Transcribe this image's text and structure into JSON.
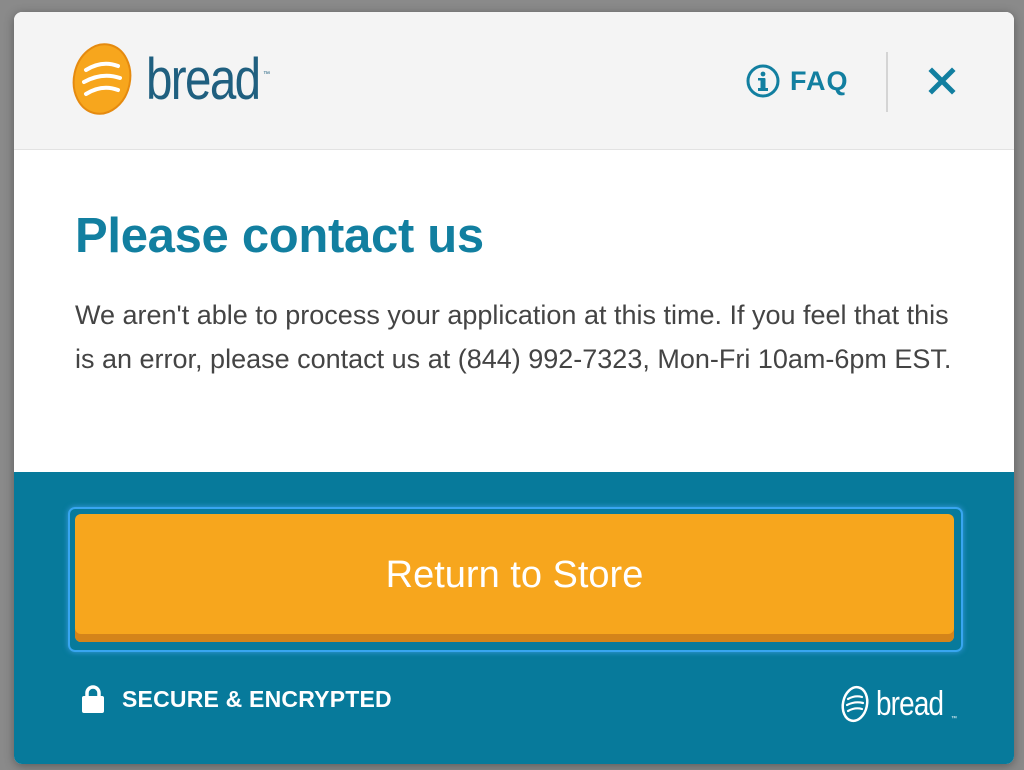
{
  "brand": {
    "name": "bread",
    "trademark": "™",
    "colors": {
      "primary_teal": "#127fa0",
      "logo_navy": "#1f5f7f",
      "orange": "#f7a61d",
      "footer_bg": "#077a9b"
    }
  },
  "header": {
    "logo_icon": "bread-loaf-icon",
    "faq_icon": "info-circle-icon",
    "faq_label": "FAQ",
    "close_icon": "close-icon"
  },
  "main": {
    "title": "Please contact us",
    "message": "We aren't able to process your application at this time. If you feel that this is an error, please contact us at (844) 992-7323, Mon-Fri 10am-6pm EST."
  },
  "footer": {
    "cta_label": "Return to Store",
    "lock_icon": "lock-icon",
    "secure_label": "SECURE & ENCRYPTED",
    "logo_text": "bread",
    "logo_tm": "™"
  }
}
